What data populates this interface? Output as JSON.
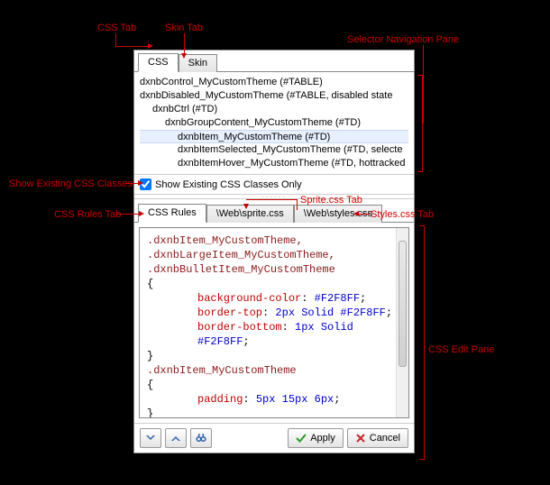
{
  "tabs_top": {
    "css": "CSS",
    "skin": "Skin"
  },
  "selector_tree": [
    {
      "indent": 0,
      "text": "dxnbControl_MyCustomTheme (#TABLE)"
    },
    {
      "indent": 0,
      "text": "dxnbDisabled_MyCustomTheme (#TABLE, disabled state"
    },
    {
      "indent": 1,
      "text": "dxnbCtrl (#TD)"
    },
    {
      "indent": 2,
      "text": "dxnbGroupContent_MyCustomTheme (#TD)"
    },
    {
      "indent": 3,
      "text": "dxnbItem_MyCustomTheme (#TD)",
      "highlight": true
    },
    {
      "indent": 3,
      "text": "dxnbItemSelected_MyCustomTheme (#TD, selecte"
    },
    {
      "indent": 3,
      "text": "dxnbItemHover_MyCustomTheme (#TD, hottracked"
    }
  ],
  "checkbox": {
    "label": "Show Existing CSS Classes Only",
    "checked": true
  },
  "tabs_mid": {
    "rules": "CSS Rules",
    "sprite": "\\Web\\sprite.css",
    "styles": "\\Web\\styles.css"
  },
  "code": {
    "sel1": ".dxnbItem_MyCustomTheme,",
    "sel2": ".dxnbLargeItem_MyCustomTheme,",
    "sel3": ".dxnbBulletItem_MyCustomTheme",
    "p1": "background-color",
    "v1": "#F2F8FF",
    "p2": "border-top",
    "v2": "2px Solid #F2F8FF",
    "p3": "border-bottom",
    "v3": "1px Solid #F2F8FF",
    "sel4": ".dxnbItem_MyCustomTheme",
    "p4": "padding",
    "v4": "5px 15px 6px"
  },
  "buttons": {
    "apply": "Apply",
    "cancel": "Cancel"
  },
  "annotations": {
    "css_tab": "CSS Tab",
    "skin_tab": "Skin Tab",
    "selector_pane": "Selector Navigation Pane",
    "show_existing": "Show Existing CSS Classes",
    "css_rules_tab": "CSS Rules Tab",
    "sprite_tab": "Sprite.css Tab",
    "styles_tab": "Styles.css Tab",
    "css_edit_pane": "CSS Edit Pane"
  }
}
